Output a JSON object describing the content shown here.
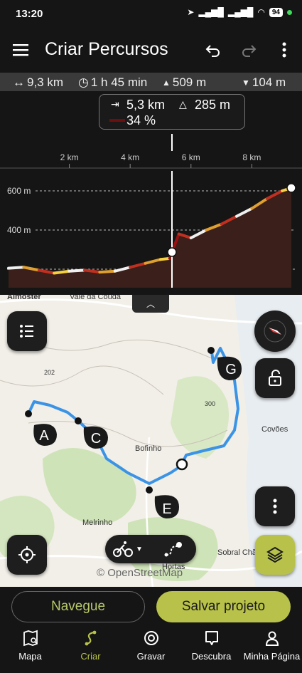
{
  "status": {
    "time": "13:20",
    "battery": "94"
  },
  "appbar": {
    "title": "Criar Percursos"
  },
  "stats": {
    "distance": "9,3 km",
    "duration": "1 h 45 min",
    "ascent": "509 m",
    "descent": "104 m"
  },
  "tooltip": {
    "distance": "5,3 km",
    "elevation": "285 m",
    "grade": "34 %"
  },
  "chart_data": {
    "type": "area",
    "x_axis_ticks": [
      "2 km",
      "4 km",
      "6 km",
      "8 km"
    ],
    "y_axis_ticks": [
      "600 m",
      "400 m"
    ],
    "x": [
      0,
      0.5,
      1,
      1.5,
      2,
      2.5,
      3,
      3.5,
      4,
      4.5,
      5,
      5.3,
      5.6,
      6,
      6.5,
      7,
      7.5,
      8,
      8.5,
      9,
      9.3
    ],
    "y": [
      205,
      210,
      195,
      180,
      190,
      195,
      185,
      190,
      210,
      230,
      250,
      255,
      380,
      360,
      400,
      430,
      470,
      510,
      560,
      600,
      615
    ]
  },
  "map": {
    "labels": [
      "Almoster",
      "Vale da Couda",
      "Bofinho",
      "Covões",
      "Melrinho",
      "Hortas",
      "Sobral Chão",
      "© OpenStreetMap",
      "300",
      "202"
    ],
    "waypoints": [
      "A",
      "C",
      "E",
      "G"
    ]
  },
  "actions": {
    "navigate": "Navegue",
    "save": "Salvar projeto"
  },
  "nav": {
    "map": "Mapa",
    "create": "Criar",
    "record": "Gravar",
    "discover": "Descubra",
    "mypage": "Minha Página"
  },
  "colors": {
    "accent": "#b8c24a",
    "route": "#3b93e6"
  }
}
